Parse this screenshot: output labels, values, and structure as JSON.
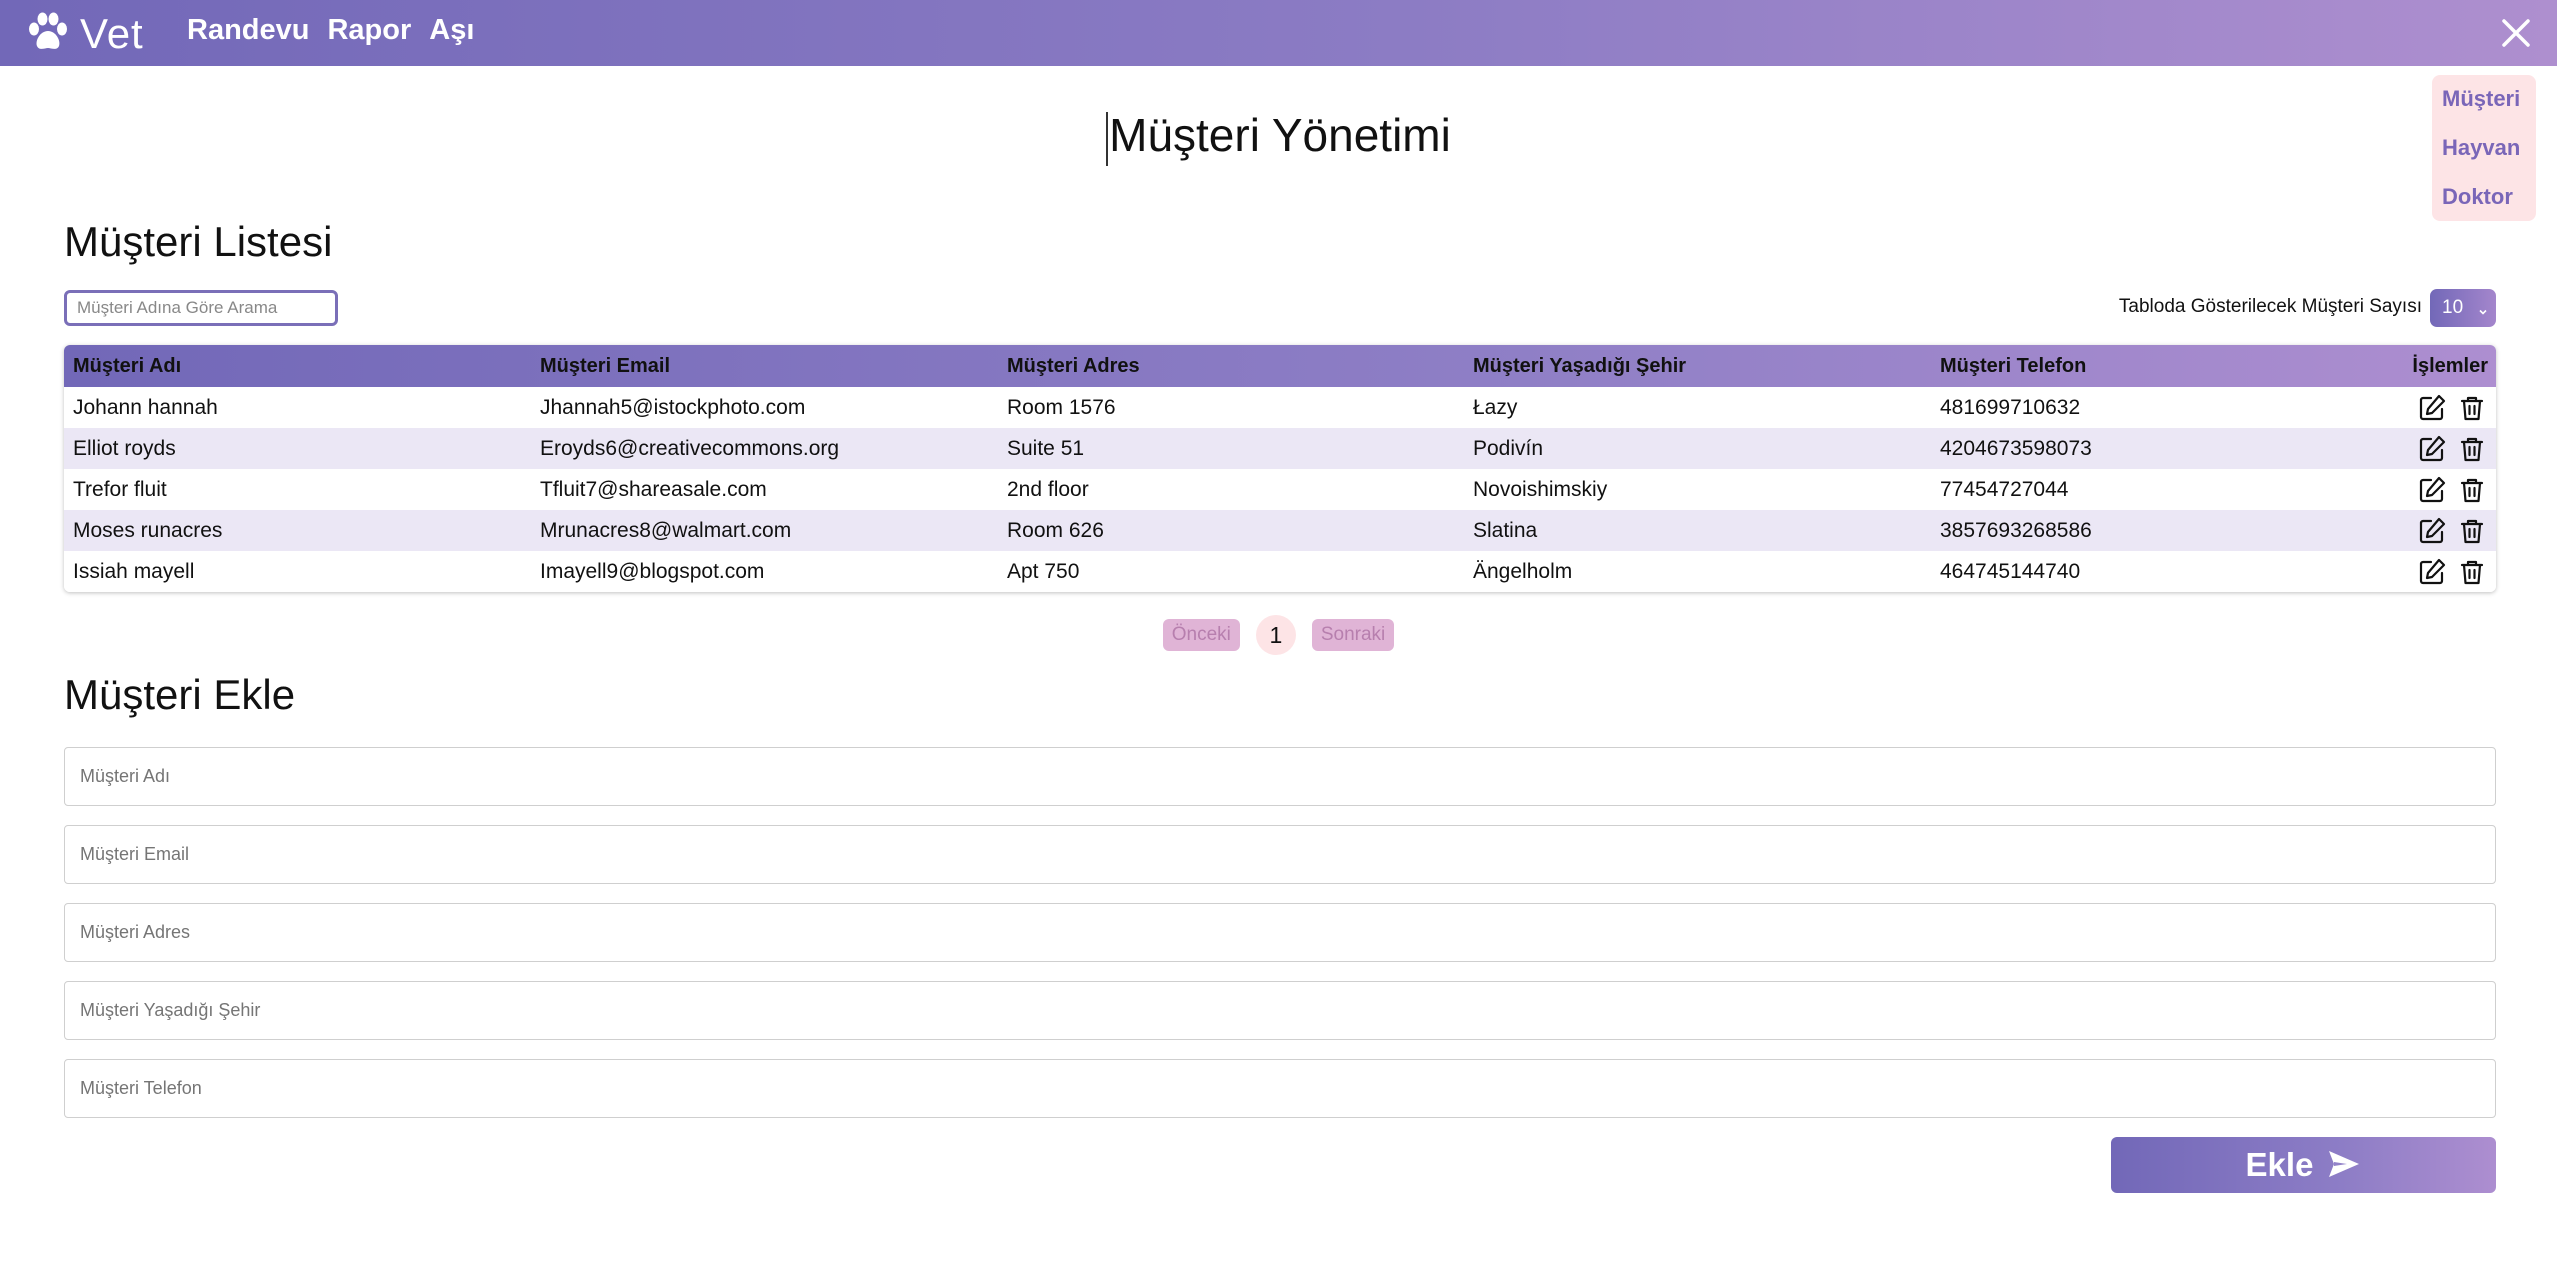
{
  "app": {
    "brand": "Vet",
    "nav": [
      {
        "label": "Randevu"
      },
      {
        "label": "Rapor"
      },
      {
        "label": "Aşı"
      }
    ]
  },
  "side_menu": {
    "items": [
      {
        "label": "Müşteri"
      },
      {
        "label": "Hayvan"
      },
      {
        "label": "Doktor"
      }
    ]
  },
  "page_title": "Müşteri Yönetimi",
  "list": {
    "title": "Müşteri Listesi",
    "search_placeholder": "Müşteri Adına Göre Arama",
    "page_size_label": "Tabloda Gösterilecek Müşteri Sayısı",
    "page_size_value": "10",
    "columns": {
      "name": "Müşteri Adı",
      "email": "Müşteri Email",
      "address": "Müşteri Adres",
      "city": "Müşteri Yaşadığı Şehir",
      "phone": "Müşteri Telefon",
      "actions": "İşlemler"
    },
    "rows": [
      {
        "name": "Johann hannah",
        "email": "Jhannah5@istockphoto.com",
        "address": "Room 1576",
        "city": "Łazy",
        "phone": "481699710632"
      },
      {
        "name": "Elliot royds",
        "email": "Eroyds6@creativecommons.org",
        "address": "Suite 51",
        "city": "Podivín",
        "phone": "4204673598073"
      },
      {
        "name": "Trefor fluit",
        "email": "Tfluit7@shareasale.com",
        "address": "2nd floor",
        "city": "Novoishimskiy",
        "phone": "77454727044"
      },
      {
        "name": "Moses runacres",
        "email": "Mrunacres8@walmart.com",
        "address": "Room 626",
        "city": "Slatina",
        "phone": "3857693268586"
      },
      {
        "name": "Issiah mayell",
        "email": "Imayell9@blogspot.com",
        "address": "Apt 750",
        "city": "Ängelholm",
        "phone": "464745144740"
      }
    ]
  },
  "pagination": {
    "prev_label": "Önceki",
    "current_page": "1",
    "next_label": "Sonraki"
  },
  "add_form": {
    "title": "Müşteri Ekle",
    "name_placeholder": "Müşteri Adı",
    "email_placeholder": "Müşteri Email",
    "address_placeholder": "Müşteri Adres",
    "city_placeholder": "Müşteri Yaşadığı Şehir",
    "phone_placeholder": "Müşteri Telefon",
    "submit_label": "Ekle"
  },
  "colors": {
    "accent_start": "#7268b8",
    "accent_end": "#ad8ed0",
    "side_menu_bg": "#fde4e6",
    "row_alt_bg": "#ebe7f5",
    "pager_button_bg": "#e0b4d6"
  },
  "icons": {
    "brand": "paw-icon",
    "close": "close-icon",
    "edit": "edit-icon",
    "delete": "trash-icon",
    "submit": "send-icon",
    "select": "chevron-down-icon"
  }
}
